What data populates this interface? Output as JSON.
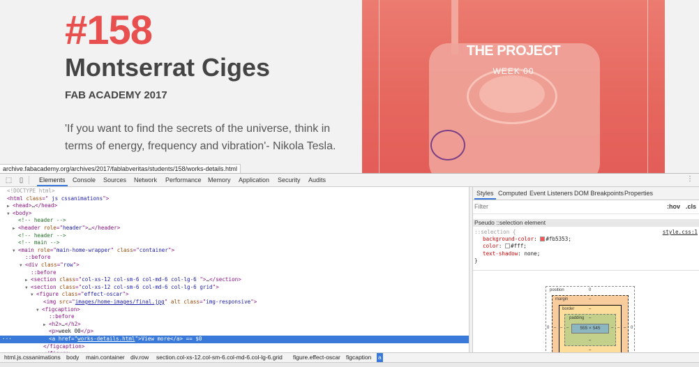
{
  "page": {
    "number": "#158",
    "name": "Montserrat Ciges",
    "subtitle": "FAB ACADEMY 2017",
    "quote": "'If you want to find the secrets of the universe, think in terms of energy, frequency and vibration'- Nikola Tesla.",
    "hero_title": "THE PROJECT",
    "hero_sub": "WEEK 00",
    "status_url": "archive.fabacademy.org/archives/2017/fablabveritas/students/158/works-details.html"
  },
  "devtools": {
    "tabs": [
      "Elements",
      "Console",
      "Sources",
      "Network",
      "Performance",
      "Memory",
      "Application",
      "Security",
      "Audits"
    ],
    "active_tab": "Elements",
    "dom_selected_index": 21,
    "styles_tabs": [
      "Styles",
      "Computed",
      "Event Listeners",
      "DOM Breakpoints",
      "Properties"
    ],
    "filter_placeholder": "Filter",
    "filter_hov": ":hov",
    "filter_cls": ".cls",
    "pseudo_header": "Pseudo ::selection element",
    "rule_selector": "::selection {",
    "rule_source": "style.css:1",
    "rule_props": [
      {
        "name": "background-color",
        "value": "#fb5353;",
        "swatch": "#fb5353"
      },
      {
        "name": "color",
        "value": "#fff;",
        "swatch": "#ffffff"
      },
      {
        "name": "text-shadow",
        "value": "none;",
        "swatch": ""
      }
    ],
    "rule_close": "}",
    "boxmodel": {
      "position_label": "position",
      "position_val": "0",
      "margin_label": "margin",
      "margin_val": "–",
      "border_label": "border",
      "border_val": "–",
      "padding_label": "padding",
      "padding_val": "–",
      "content": "555 × 545",
      "side_zero": "0",
      "dash": "–"
    },
    "breadcrumbs": [
      "html.js.cssanimations",
      "body",
      "main.container",
      "div.row",
      "section.col-xs-12.col-sm-6.col-md-6.col-lg-6.grid",
      "figure.effect-oscar",
      "figcaption",
      "a"
    ],
    "active_crumb": "a"
  }
}
